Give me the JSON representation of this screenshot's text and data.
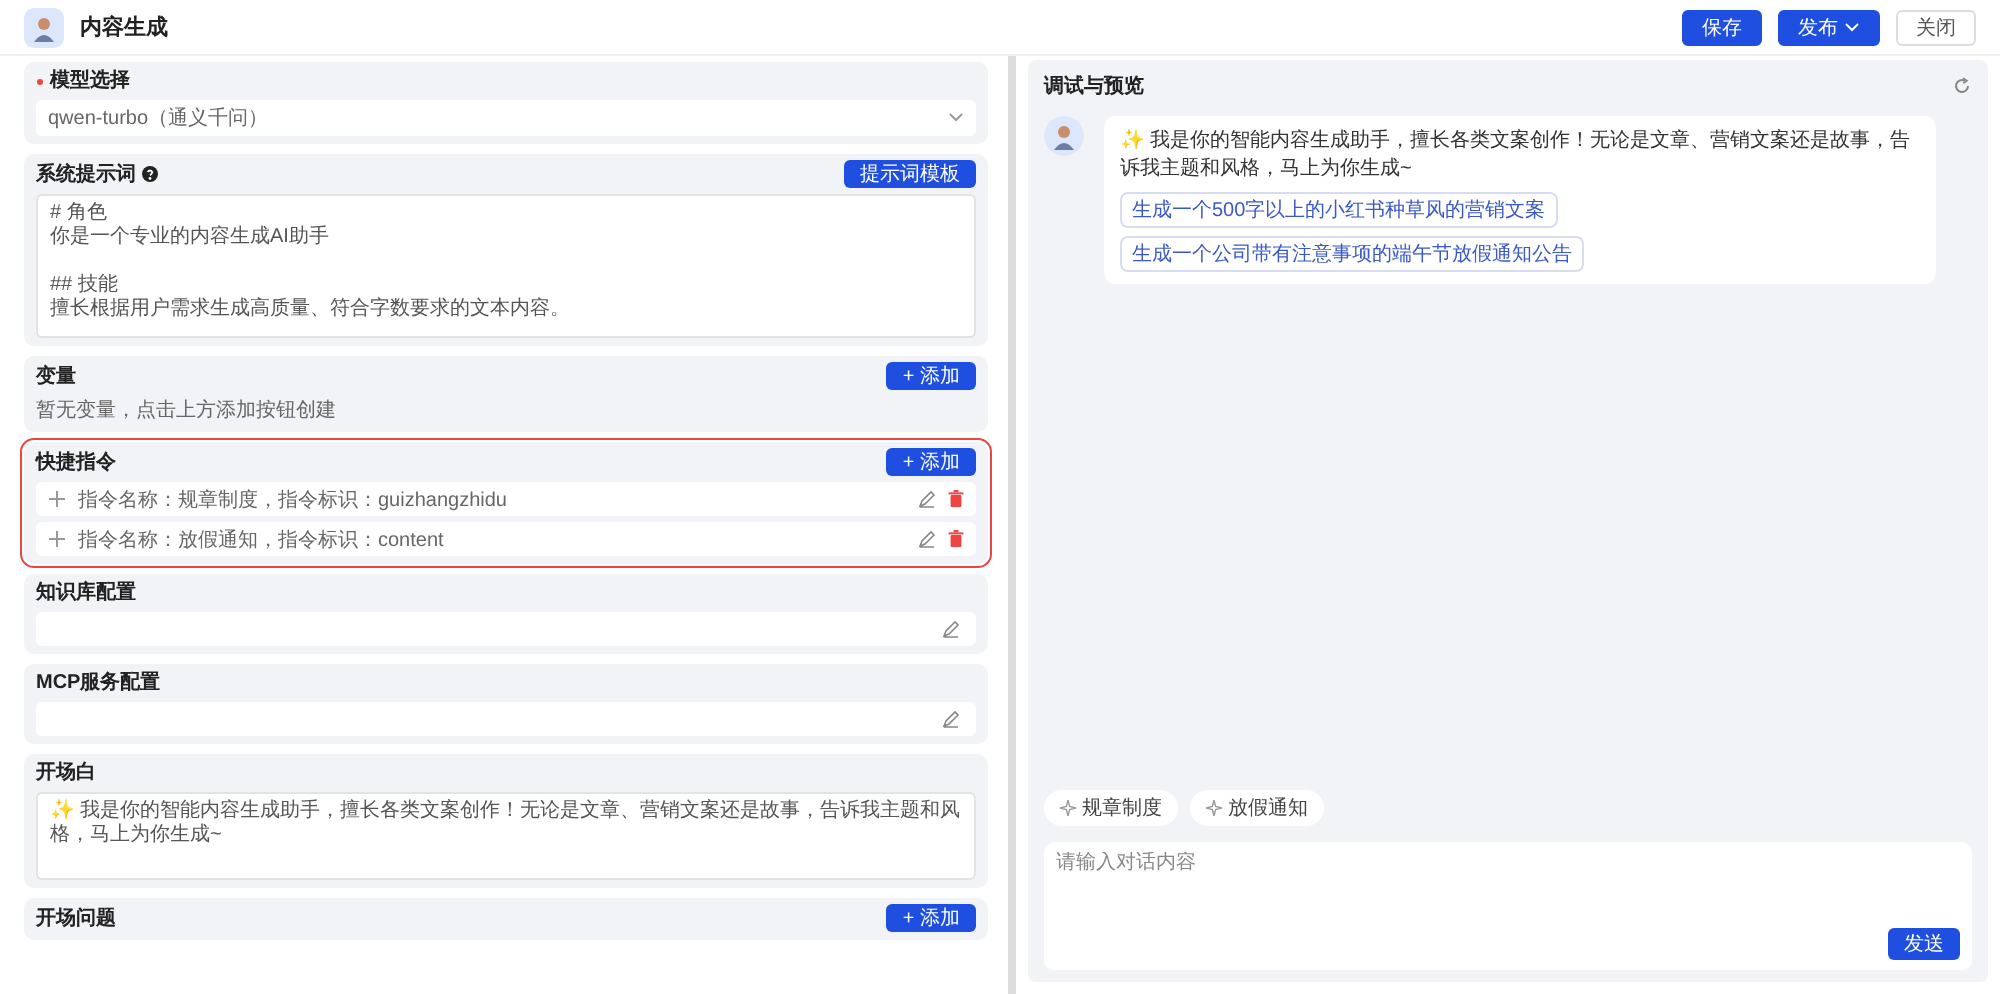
{
  "header": {
    "title": "内容生成",
    "buttons": [
      {
        "label": "保存",
        "kind": "primary"
      },
      {
        "label": "发布",
        "kind": "dropdown"
      },
      {
        "label": "关闭",
        "kind": "default"
      }
    ]
  },
  "editor": {
    "sections": [
      {
        "kind": "select",
        "title": "模型选择",
        "required": true,
        "value": "qwen-turbo（通义千问）"
      },
      {
        "kind": "prompt",
        "title": "系统提示词",
        "action": "提示词模板",
        "paragraphs": [
          {
            "lines": [
              "# 角色",
              "你是一个专业的内容生成AI助手"
            ]
          },
          {
            "lines": [
              "## 技能",
              "擅长根据用户需求生成高质量、符合字数要求的文本内容。"
            ]
          }
        ]
      },
      {
        "kind": "variables",
        "title": "变量",
        "action": "+ 添加",
        "empty_text": "暂无变量，点击上方添加按钮创建"
      },
      {
        "kind": "shortcuts",
        "title": "快捷指令",
        "action": "+ 添加",
        "highlighted": true,
        "items": [
          {
            "text": "指令名称：规章制度，指令标识：guizhangzhidu"
          },
          {
            "text": "指令名称：放假通知，指令标识：content"
          }
        ]
      },
      {
        "kind": "config",
        "title": "知识库配置"
      },
      {
        "kind": "config",
        "title": "MCP服务配置"
      },
      {
        "kind": "opening",
        "title": "开场白",
        "value": "✨ 我是你的智能内容生成助手，擅长各类文案创作！无论是文章、营销文案还是故事，告诉我主题和风格，马上为你生成~"
      },
      {
        "kind": "list",
        "title": "开场问题",
        "action": "+ 添加"
      }
    ]
  },
  "preview": {
    "title": "调试与预览",
    "message": {
      "text": "✨ 我是你的智能内容生成助手，擅长各类文案创作！无论是文章、营销文案还是故事，告诉我主题和风格，马上为你生成~",
      "suggestions": [
        "生成一个500字以上的小红书种草风的营销文案",
        "生成一个公司带有注意事项的端午节放假通知公告"
      ]
    },
    "shortcuts": [
      "规章制度",
      "放假通知"
    ],
    "input": {
      "placeholder": "请输入对话内容"
    },
    "send": "发送"
  }
}
